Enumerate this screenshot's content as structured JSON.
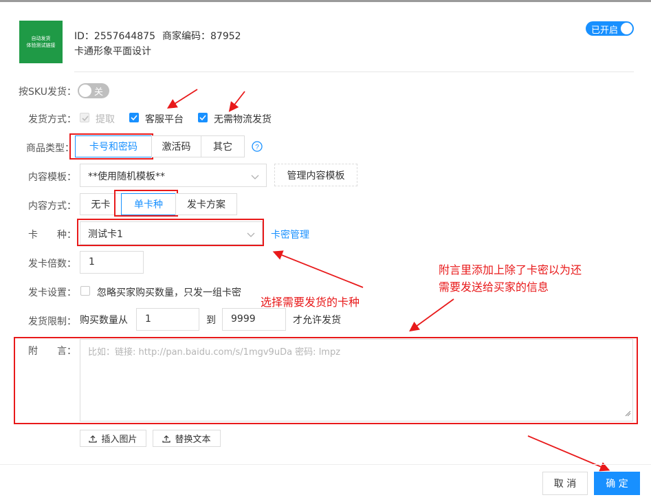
{
  "product": {
    "thumb_line1": "自动发货",
    "thumb_line2": "体验测试链接",
    "id_text": "ID：2557644875",
    "code_text": "商家编码：87952",
    "title": "卡通形象平面设计"
  },
  "status_toggle": {
    "label": "已开启",
    "on": true
  },
  "sku": {
    "label": "按SKU发货：",
    "toggle_label": "关",
    "on": false
  },
  "delivery_method": {
    "label": "发货方式：",
    "options": [
      {
        "label": "提取",
        "checked": true,
        "disabled": true
      },
      {
        "label": "客服平台",
        "checked": true,
        "disabled": false
      },
      {
        "label": "无需物流发货",
        "checked": true,
        "disabled": false
      }
    ]
  },
  "product_type": {
    "label": "商品类型：",
    "options": [
      "卡号和密码",
      "激活码",
      "其它"
    ],
    "selected": "卡号和密码",
    "help_icon": "question-circle-icon"
  },
  "content_template": {
    "label": "内容模板：",
    "value": "**使用随机模板**",
    "manage_button": "管理内容模板"
  },
  "content_mode": {
    "label": "内容方式：",
    "options": [
      "无卡",
      "单卡种",
      "发卡方案"
    ],
    "selected": "单卡种"
  },
  "card_type": {
    "label": "卡　　种：",
    "value": "测试卡1",
    "manage_link": "卡密管理"
  },
  "multiplier": {
    "label": "发卡倍数：",
    "value": "1"
  },
  "card_settings": {
    "label": "发卡设置：",
    "option": "忽略买家购买数量，只发一组卡密",
    "checked": false
  },
  "limit": {
    "label": "发货限制：",
    "prefix": "购买数量从",
    "from": "1",
    "to_label": "到",
    "to": "9999",
    "suffix": "才允许发货"
  },
  "note": {
    "label": "附　　言：",
    "placeholder": "比如：链接: http://pan.baidu.com/s/1mgv9uDa 密码: lmpz"
  },
  "note_buttons": {
    "insert_image": "插入图片",
    "replace_text": "替换文本"
  },
  "annotations": {
    "select_card": "选择需要发货的卡种",
    "note_hint_line1": "附言里添加上除了卡密以为还",
    "note_hint_line2": "需要发送给买家的信息"
  },
  "footer": {
    "cancel": "取 消",
    "confirm": "确 定"
  },
  "colors": {
    "primary": "#1890ff",
    "annotation_red": "#e8191a",
    "thumb_green": "#1f9a46"
  }
}
